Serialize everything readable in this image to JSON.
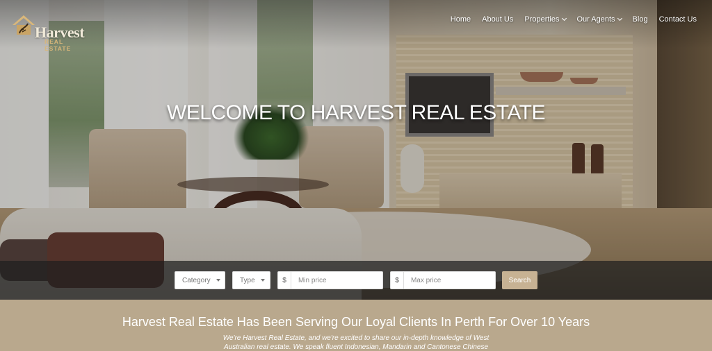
{
  "header": {
    "logo": {
      "name": "Harvest",
      "subtitle": "REAL ESTATE"
    },
    "nav": [
      {
        "label": "Home"
      },
      {
        "label": "About Us"
      },
      {
        "label": "Properties",
        "has_dropdown": true
      },
      {
        "label": "Our Agents",
        "has_dropdown": true
      },
      {
        "label": "Blog"
      },
      {
        "label": "Contact Us"
      }
    ]
  },
  "hero": {
    "title": "WELCOME TO HARVEST REAL ESTATE"
  },
  "search": {
    "category": "Category",
    "type": "Type",
    "currency_symbol": "$",
    "min_price_placeholder": "Min price",
    "max_price_placeholder": "Max price",
    "button_label": "Search",
    "button_color": "#c7b293"
  },
  "intro": {
    "heading": "Harvest Real Estate Has Been Serving Our Loyal Clients In Perth For Over 10 Years",
    "text": "We're Harvest Real Estate, and we're excited to share our in-depth knowledge of West Australian real estate. We speak fluent Indonesian, Mandarin and Cantonese Chinese",
    "background_color": "#b9a88d"
  }
}
